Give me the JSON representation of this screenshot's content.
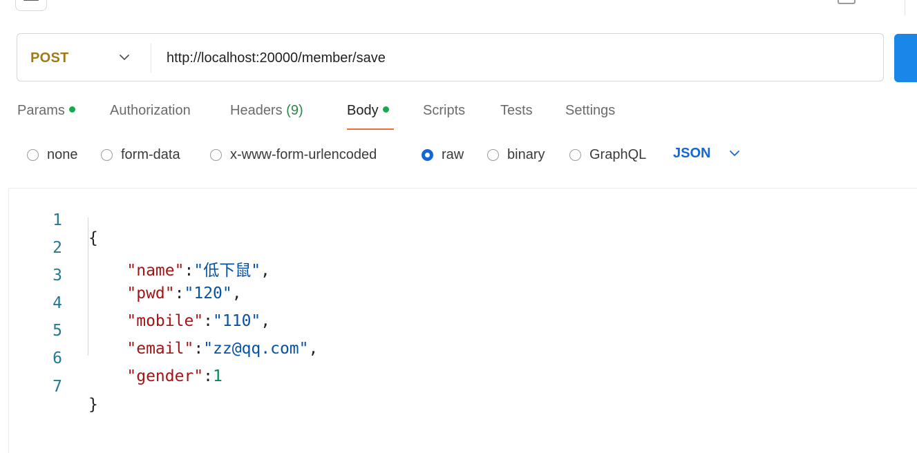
{
  "request": {
    "method": "POST",
    "url": "http://localhost:20000/member/save"
  },
  "tabs": [
    {
      "label": "Params",
      "has_dot": true
    },
    {
      "label": "Authorization"
    },
    {
      "label": "Headers ",
      "count": "(9)"
    },
    {
      "label": "Body",
      "has_dot": true,
      "active": true
    },
    {
      "label": "Scripts"
    },
    {
      "label": "Tests"
    },
    {
      "label": "Settings"
    }
  ],
  "body_modes": [
    {
      "label": "none",
      "selected": false
    },
    {
      "label": "form-data",
      "selected": false
    },
    {
      "label": "x-www-form-urlencoded",
      "selected": false
    },
    {
      "label": "raw",
      "selected": true
    },
    {
      "label": "binary",
      "selected": false
    },
    {
      "label": "GraphQL",
      "selected": false
    }
  ],
  "raw_format": "JSON",
  "editor": {
    "line_numbers": [
      "1",
      "2",
      "3",
      "4",
      "5",
      "6",
      "7"
    ],
    "lines": [
      {
        "open": "{"
      },
      {
        "key": "\"name\"",
        "colon": ":",
        "value": "\"低下鼠\"",
        "comma": ","
      },
      {
        "key": "\"pwd\"",
        "colon": ":",
        "value": "\"120\"",
        "comma": ","
      },
      {
        "key": "\"mobile\"",
        "colon": ":",
        "value": "\"110\"",
        "comma": ","
      },
      {
        "key": "\"email\"",
        "colon": ":",
        "value": "\"zz@qq.com\"",
        "comma": ","
      },
      {
        "key": "\"gender\"",
        "colon": ":",
        "number": "1"
      },
      {
        "close": "}"
      }
    ]
  },
  "colors": {
    "method": "#a17a12",
    "accent_blue": "#1467d4",
    "send_button": "#1a86e8",
    "active_tab_underline": "#f26b3a",
    "status_dot": "#18a84f",
    "json_key": "#a31515",
    "json_string": "#0451a5",
    "json_number": "#098658",
    "line_number": "#237893"
  }
}
